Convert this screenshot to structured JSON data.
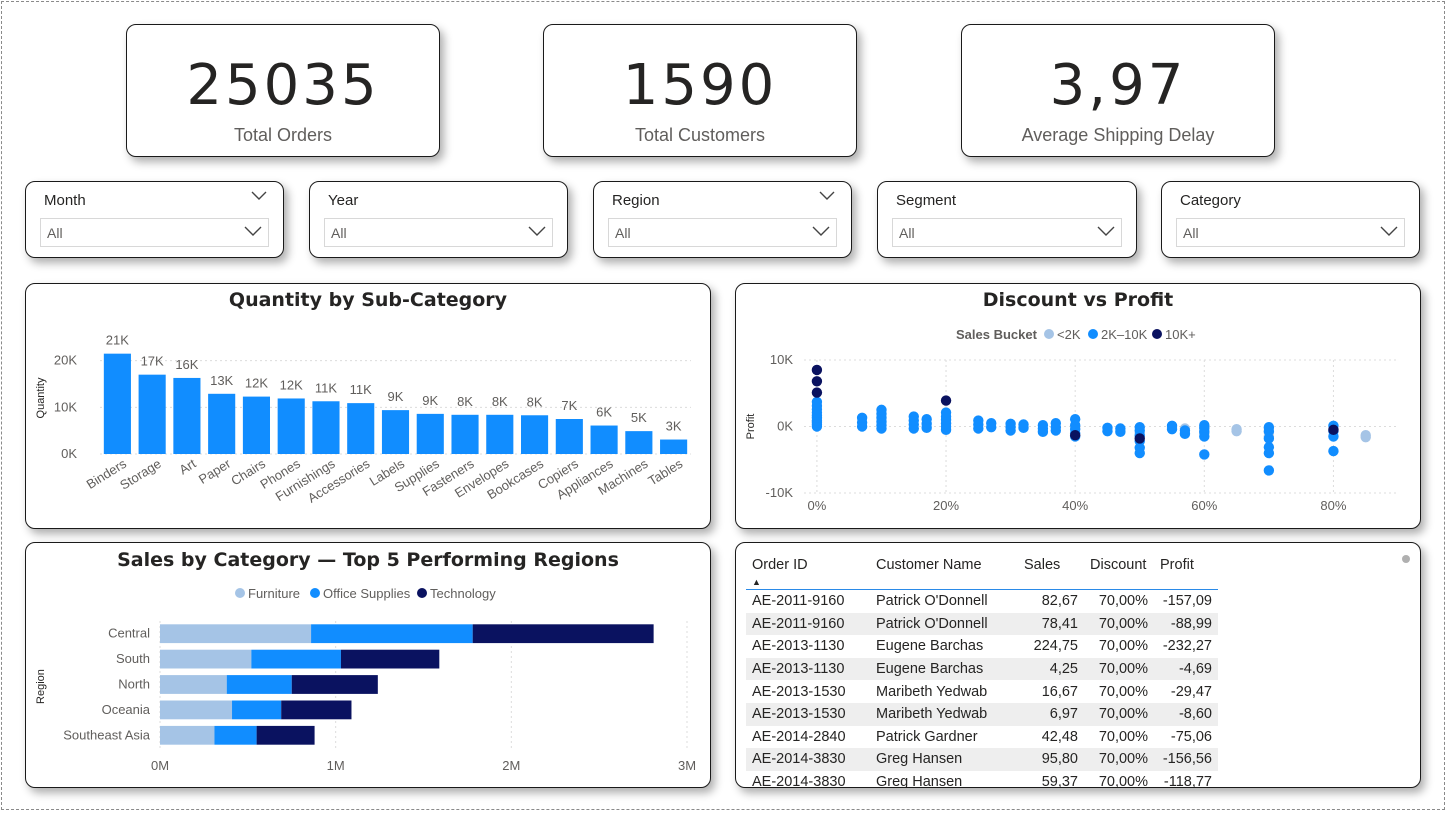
{
  "kpis": [
    {
      "value": "25035",
      "label": "Total Orders"
    },
    {
      "value": "1590",
      "label": "Total Customers"
    },
    {
      "value": "3,97",
      "label": "Average Shipping Delay"
    }
  ],
  "slicers": [
    {
      "title": "Month",
      "value": "All",
      "header_chevron": true
    },
    {
      "title": "Year",
      "value": "All",
      "header_chevron": false
    },
    {
      "title": "Region",
      "value": "All",
      "header_chevron": true
    },
    {
      "title": "Segment",
      "value": "All",
      "header_chevron": false
    },
    {
      "title": "Category",
      "value": "All",
      "header_chevron": false
    }
  ],
  "colors": {
    "accent": "#118DFF",
    "light": "#A5C4E6",
    "dark": "#0A1260",
    "darker_point": "#2A2F6C",
    "grid": "#dcdcdc",
    "header_line": "#2a8ae8"
  },
  "quantity_chart": {
    "chart_data": {
      "type": "bar",
      "title": "Quantity by Sub-Category",
      "ylabel": "Quantity",
      "xlabel": "",
      "categories": [
        "Binders",
        "Storage",
        "Art",
        "Paper",
        "Chairs",
        "Phones",
        "Furnishings",
        "Accessories",
        "Labels",
        "Supplies",
        "Fasteners",
        "Envelopes",
        "Bookcases",
        "Copiers",
        "Appliances",
        "Machines",
        "Tables"
      ],
      "values": [
        21500,
        17000,
        16300,
        12900,
        12300,
        11900,
        11300,
        10900,
        9400,
        8600,
        8400,
        8400,
        8300,
        7500,
        6100,
        4900,
        3100
      ],
      "data_labels": [
        "21K",
        "17K",
        "16K",
        "13K",
        "12K",
        "12K",
        "11K",
        "11K",
        "9K",
        "9K",
        "8K",
        "8K",
        "8K",
        "7K",
        "6K",
        "5K",
        "3K"
      ],
      "y_ticks": [
        "0K",
        "10K",
        "20K"
      ],
      "ylim": [
        0,
        24000
      ],
      "grid": true
    }
  },
  "scatter_chart": {
    "chart_data": {
      "type": "scatter",
      "title": "Discount vs Profit",
      "xlabel": "",
      "ylabel": "Profit",
      "legend_title": "Sales Bucket",
      "legend_position": "top-center",
      "series": [
        {
          "name": "<2K",
          "color": "#A5C4E6",
          "points": [
            [
              0.55,
              -200
            ],
            [
              0.57,
              -300
            ],
            [
              0.6,
              -800
            ],
            [
              0.6,
              -1000
            ],
            [
              0.65,
              -400
            ],
            [
              0.65,
              -700
            ],
            [
              0.7,
              -300
            ],
            [
              0.7,
              -900
            ],
            [
              0.8,
              -600
            ],
            [
              0.85,
              -1300
            ],
            [
              0.85,
              -1600
            ],
            [
              0,
              800
            ],
            [
              0.2,
              400
            ],
            [
              0.4,
              -200
            ],
            [
              0.5,
              -1000
            ],
            [
              0.6,
              -300
            ],
            [
              0.7,
              -1500
            ]
          ]
        },
        {
          "name": "2K–10K",
          "color": "#118DFF",
          "points": [
            [
              0,
              0
            ],
            [
              0,
              300
            ],
            [
              0,
              600
            ],
            [
              0,
              900
            ],
            [
              0,
              1300
            ],
            [
              0,
              1700
            ],
            [
              0,
              2100
            ],
            [
              0,
              2600
            ],
            [
              0,
              3100
            ],
            [
              0,
              3700
            ],
            [
              0.07,
              0
            ],
            [
              0.07,
              600
            ],
            [
              0.07,
              1300
            ],
            [
              0.1,
              -300
            ],
            [
              0.1,
              200
            ],
            [
              0.1,
              700
            ],
            [
              0.1,
              1300
            ],
            [
              0.1,
              1900
            ],
            [
              0.1,
              2500
            ],
            [
              0.15,
              -300
            ],
            [
              0.15,
              300
            ],
            [
              0.15,
              900
            ],
            [
              0.15,
              1500
            ],
            [
              0.17,
              -200
            ],
            [
              0.17,
              400
            ],
            [
              0.17,
              1100
            ],
            [
              0.2,
              -500
            ],
            [
              0.2,
              0
            ],
            [
              0.2,
              500
            ],
            [
              0.2,
              1000
            ],
            [
              0.2,
              1500
            ],
            [
              0.2,
              2100
            ],
            [
              0.25,
              -300
            ],
            [
              0.25,
              300
            ],
            [
              0.25,
              900
            ],
            [
              0.27,
              -100
            ],
            [
              0.27,
              500
            ],
            [
              0.3,
              -600
            ],
            [
              0.3,
              -100
            ],
            [
              0.3,
              400
            ],
            [
              0.32,
              -200
            ],
            [
              0.32,
              300
            ],
            [
              0.35,
              -800
            ],
            [
              0.35,
              -300
            ],
            [
              0.35,
              200
            ],
            [
              0.37,
              -600
            ],
            [
              0.37,
              -100
            ],
            [
              0.37,
              500
            ],
            [
              0.4,
              -1500
            ],
            [
              0.4,
              -1000
            ],
            [
              0.4,
              -400
            ],
            [
              0.4,
              200
            ],
            [
              0.4,
              1100
            ],
            [
              0.45,
              -700
            ],
            [
              0.45,
              -200
            ],
            [
              0.47,
              -800
            ],
            [
              0.47,
              -300
            ],
            [
              0.5,
              -4000
            ],
            [
              0.5,
              -3200
            ],
            [
              0.5,
              -2200
            ],
            [
              0.5,
              -1400
            ],
            [
              0.5,
              -600
            ],
            [
              0.5,
              -100
            ],
            [
              0.55,
              -400
            ],
            [
              0.55,
              100
            ],
            [
              0.57,
              -1100
            ],
            [
              0.57,
              -600
            ],
            [
              0.6,
              -4200
            ],
            [
              0.6,
              -1500
            ],
            [
              0.6,
              -800
            ],
            [
              0.6,
              -200
            ],
            [
              0.6,
              200
            ],
            [
              0.7,
              -6600
            ],
            [
              0.7,
              -4000
            ],
            [
              0.7,
              -3100
            ],
            [
              0.7,
              -1800
            ],
            [
              0.7,
              -700
            ],
            [
              0.7,
              -100
            ],
            [
              0.8,
              -3700
            ],
            [
              0.8,
              -1500
            ],
            [
              0.8,
              -700
            ],
            [
              0.8,
              100
            ]
          ]
        },
        {
          "name": "10K+",
          "color": "#0A1260",
          "points": [
            [
              0,
              8500
            ],
            [
              0,
              6800
            ],
            [
              0,
              5100
            ],
            [
              0.2,
              3900
            ],
            [
              0.4,
              -1300
            ],
            [
              0.5,
              -1800
            ],
            [
              0.8,
              -500
            ]
          ]
        }
      ],
      "x_ticks": [
        "0%",
        "20%",
        "40%",
        "60%",
        "80%"
      ],
      "y_ticks": [
        "-10K",
        "0K",
        "10K"
      ],
      "xlim": [
        -0.02,
        0.9
      ],
      "ylim": [
        -10000,
        10000
      ],
      "grid": true
    }
  },
  "region_chart": {
    "chart_data": {
      "type": "bar",
      "orientation": "horizontal-stacked",
      "title": "Sales by Category — Top 5 Performing Regions",
      "xlabel": "",
      "ylabel": "Region",
      "legend_position": "top-center",
      "categories": [
        "Central",
        "South",
        "North",
        "Oceania",
        "Southeast Asia"
      ],
      "series": [
        {
          "name": "Furniture",
          "color": "#A5C4E6",
          "values": [
            860000,
            520000,
            380000,
            410000,
            310000
          ]
        },
        {
          "name": "Office Supplies",
          "color": "#118DFF",
          "values": [
            920000,
            510000,
            370000,
            280000,
            240000
          ]
        },
        {
          "name": "Technology",
          "color": "#0A1260",
          "values": [
            1030000,
            560000,
            490000,
            400000,
            330000
          ]
        }
      ],
      "x_ticks": [
        "0M",
        "1M",
        "2M",
        "3M"
      ],
      "xlim": [
        0,
        3000000
      ],
      "grid": true
    }
  },
  "orders_table": {
    "columns": [
      "Order ID",
      "Customer Name",
      "Sales",
      "Discount",
      "Profit"
    ],
    "rows": [
      [
        "AE-2011-9160",
        "Patrick O'Donnell",
        "82,67",
        "70,00%",
        "-157,09"
      ],
      [
        "AE-2011-9160",
        "Patrick O'Donnell",
        "78,41",
        "70,00%",
        "-88,99"
      ],
      [
        "AE-2013-1130",
        "Eugene Barchas",
        "224,75",
        "70,00%",
        "-232,27"
      ],
      [
        "AE-2013-1130",
        "Eugene Barchas",
        "4,25",
        "70,00%",
        "-4,69"
      ],
      [
        "AE-2013-1530",
        "Maribeth Yedwab",
        "16,67",
        "70,00%",
        "-29,47"
      ],
      [
        "AE-2013-1530",
        "Maribeth Yedwab",
        "6,97",
        "70,00%",
        "-8,60"
      ],
      [
        "AE-2014-2840",
        "Patrick Gardner",
        "42,48",
        "70,00%",
        "-75,06"
      ],
      [
        "AE-2014-3830",
        "Greg Hansen",
        "95,80",
        "70,00%",
        "-156,56"
      ],
      [
        "AE-2014-3830",
        "Greg Hansen",
        "59,37",
        "70,00%",
        "-118,77"
      ]
    ]
  }
}
